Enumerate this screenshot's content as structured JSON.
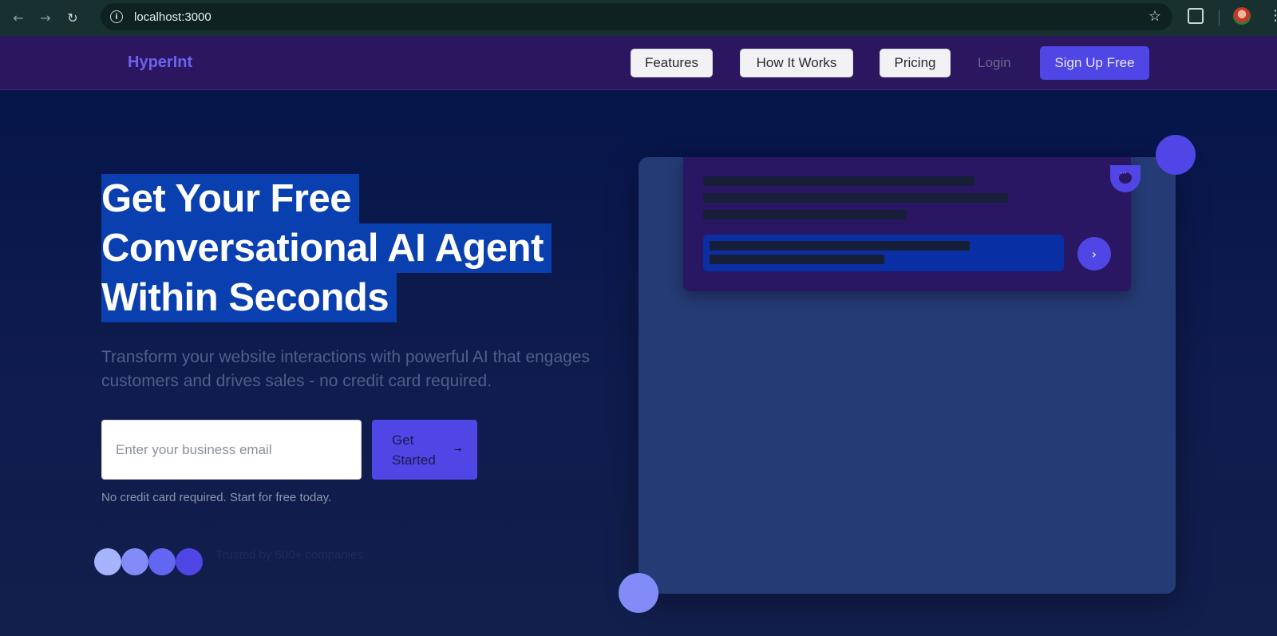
{
  "browser": {
    "url": "localhost:3000"
  },
  "nav": {
    "logo": "HyperInt",
    "features": "Features",
    "how_it_works": "How It Works",
    "pricing": "Pricing",
    "login": "Login",
    "signup": "Sign Up Free"
  },
  "hero": {
    "headline": [
      "Get Your Free",
      "Conversational AI Agent",
      "Within Seconds"
    ],
    "subtext": "Transform your website interactions with powerful AI that engages customers and drives sales - no credit card required.",
    "email_placeholder": "Enter your business email",
    "cta_label": "Get Started",
    "cta_icon": "arrow-right-icon",
    "fineprint": "No credit card required. Start for free today.",
    "trusted": "Trusted by 500+ companies",
    "avatar_colors": [
      "#a5b4fc",
      "#818cf8",
      "#6366f1",
      "#4f46e5"
    ]
  },
  "colors": {
    "brand": "#4f46e5",
    "headline_highlight": "#0a3fb0",
    "nav_bg": "#2b1660",
    "hero_bg": "#06154a"
  }
}
